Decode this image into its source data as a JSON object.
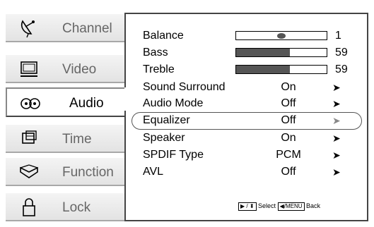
{
  "tabs": [
    {
      "label": "Channel",
      "icon": "satellite-dish-icon"
    },
    {
      "label": "Video",
      "icon": "monitor-icon"
    },
    {
      "label": "Audio",
      "icon": "audio-icon"
    },
    {
      "label": "Time",
      "icon": "time-icon"
    },
    {
      "label": "Function",
      "icon": "function-icon"
    },
    {
      "label": "Lock",
      "icon": "lock-icon"
    }
  ],
  "selected_tab": "Audio",
  "audio": {
    "balance": {
      "label": "Balance",
      "value": "1",
      "level_fraction": 0.5
    },
    "bass": {
      "label": "Bass",
      "value": "59",
      "level_fraction": 0.59
    },
    "treble": {
      "label": "Treble",
      "value": "59",
      "level_fraction": 0.59
    },
    "sound_surround": {
      "label": "Sound Surround",
      "value": "On"
    },
    "audio_mode": {
      "label": "Audio Mode",
      "value": "Off"
    },
    "equalizer": {
      "label": "Equalizer",
      "value": "Off"
    },
    "speaker": {
      "label": "Speaker",
      "value": "On"
    },
    "spdif_type": {
      "label": "SPDIF Type",
      "value": "PCM"
    },
    "avl": {
      "label": "AVL",
      "value": "Off"
    },
    "arrow": "➤",
    "highlighted_item": "Equalizer"
  },
  "help": {
    "nav_keys": "▶ / ⬍",
    "select_label": "Select",
    "back_key": "◀/MENU",
    "back_label": "Back"
  },
  "colors": {
    "bar_fill": "#555555",
    "tab_bg": "#e8e8e8",
    "border": "#444444"
  }
}
